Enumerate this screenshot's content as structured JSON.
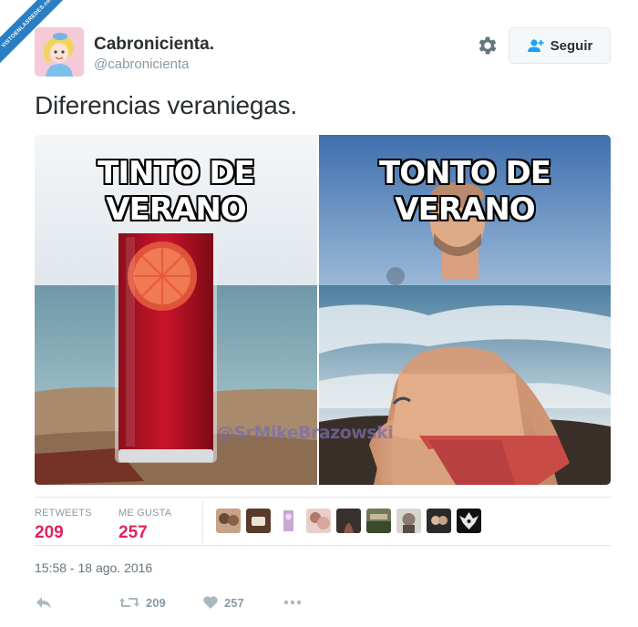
{
  "watermark_ribbon": "VISTOENLASREDES.com",
  "user": {
    "name": "Cabronicienta.",
    "handle": "@cabronicienta",
    "avatar_icon": "cinderella-avatar"
  },
  "follow_button": {
    "label": "Seguir",
    "icon": "add-user-icon"
  },
  "settings_icon": "gear-icon",
  "tweet": {
    "text": "Diferencias veraniegas."
  },
  "media": {
    "left_caption": "TINTO DE VERANO",
    "right_caption": "TONTO DE VERANO",
    "watermark": "@SrMikeBrazowski"
  },
  "stats": {
    "retweets_label": "RETWEETS",
    "retweets_value": "209",
    "likes_label": "ME GUSTA",
    "likes_value": "257",
    "accent": "#e0245e"
  },
  "likers": [
    "liker-1",
    "liker-2",
    "liker-3",
    "liker-4",
    "liker-5",
    "liker-6",
    "liker-7",
    "liker-8",
    "liker-9"
  ],
  "timestamp": "15:58 - 18 ago. 2016",
  "actions": {
    "reply_icon": "reply-icon",
    "retweet_icon": "retweet-icon",
    "retweet_count": "209",
    "like_icon": "heart-icon",
    "like_count": "257",
    "more_icon": "more-icon"
  }
}
